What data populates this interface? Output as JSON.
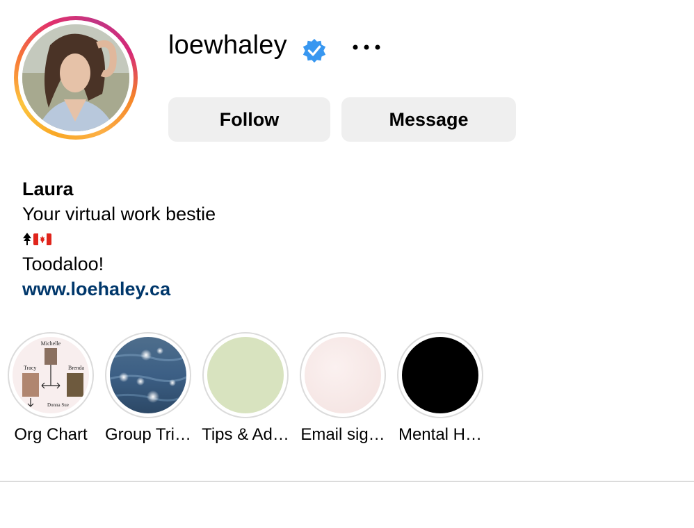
{
  "profile": {
    "username": "loewhaley",
    "verified": true,
    "more_label": "•••",
    "follow_label": "Follow",
    "message_label": "Message"
  },
  "bio": {
    "name": "Laura",
    "tagline": "Your virtual work bestie",
    "location_icons": [
      "tree-icon",
      "canada-flag-icon"
    ],
    "sign_off": "Toodaloo!",
    "link": "www.loehaley.ca"
  },
  "highlights": [
    {
      "label": "Org Chart",
      "cover": "org-chart-collage",
      "names": [
        "Michelle",
        "Tracy",
        "Brenda",
        "Donna Sue"
      ]
    },
    {
      "label": "Group Tri…",
      "cover": "sparkling-water"
    },
    {
      "label": "Tips & Ad…",
      "cover": "solid",
      "color": "#d8e3bf"
    },
    {
      "label": "Email sig…",
      "cover": "solid",
      "color": "#f6e6e4"
    },
    {
      "label": "Mental H…",
      "cover": "solid",
      "color": "#000000"
    }
  ],
  "colors": {
    "button_bg": "#efefef",
    "link": "#00376b",
    "verified_badge": "#0095f6",
    "divider": "#dbdbdb"
  }
}
